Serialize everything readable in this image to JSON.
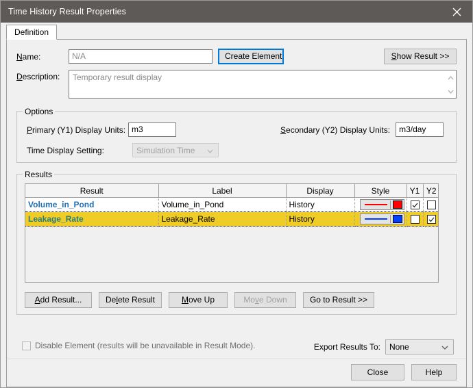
{
  "window": {
    "title": "Time History Result Properties",
    "close_icon": "close-icon"
  },
  "tabs": [
    {
      "label": "Definition"
    }
  ],
  "form": {
    "name_label": "Name:",
    "name_label_mnemonic": "N",
    "name_value": "N/A",
    "create_element_label": "Create Element",
    "create_element_mnemonic": "C",
    "show_result_label": "Show Result >>",
    "show_result_mnemonic": "S",
    "description_label": "Description:",
    "description_label_mnemonic": "D",
    "description_value": "Temporary result display"
  },
  "options": {
    "title": "Options",
    "primary_label": "Primary (Y1) Display Units:",
    "primary_mnemonic": "P",
    "primary_value": "m3",
    "secondary_label": "Secondary (Y2) Display Units:",
    "secondary_mnemonic": "S",
    "secondary_value": "m3/day",
    "time_display_label": "Time Display Setting:",
    "time_display_value": "Simulation Time",
    "time_display_enabled": false
  },
  "results": {
    "title": "Results",
    "columns": [
      "Result",
      "Label",
      "Display",
      "Style",
      "Y1",
      "Y2"
    ],
    "rows": [
      {
        "result": "Volume_in_Pond",
        "label": "Volume_in_Pond",
        "display": "History",
        "style_color": "#ff0000",
        "y1": true,
        "y2": false,
        "selected": false
      },
      {
        "result": "Leakage_Rate",
        "label": "Leakage_Rate",
        "display": "History",
        "style_color": "#0040ff",
        "y1": false,
        "y2": true,
        "selected": true
      }
    ],
    "buttons": {
      "add": "Add Result...",
      "add_mnemonic": "A",
      "delete": "Delete Result",
      "delete_mnemonic": "l",
      "move_up": "Move Up",
      "move_up_mnemonic": "M",
      "move_down": "Move Down",
      "move_down_mnemonic": "v",
      "move_down_enabled": false,
      "go_to": "Go to Result >>"
    }
  },
  "bottom": {
    "disable_element_label": "Disable Element (results will be unavailable in Result Mode).",
    "disable_element_checked": false,
    "disable_element_enabled": false,
    "export_label": "Export Results To:",
    "export_value": "None"
  },
  "footer": {
    "close_label": "Close",
    "help_label": "Help"
  },
  "colors": {
    "titlebar": "#5d5a57",
    "selection": "#efcd26",
    "accent": "#0078d7",
    "result_link": "#1f6fb5"
  }
}
